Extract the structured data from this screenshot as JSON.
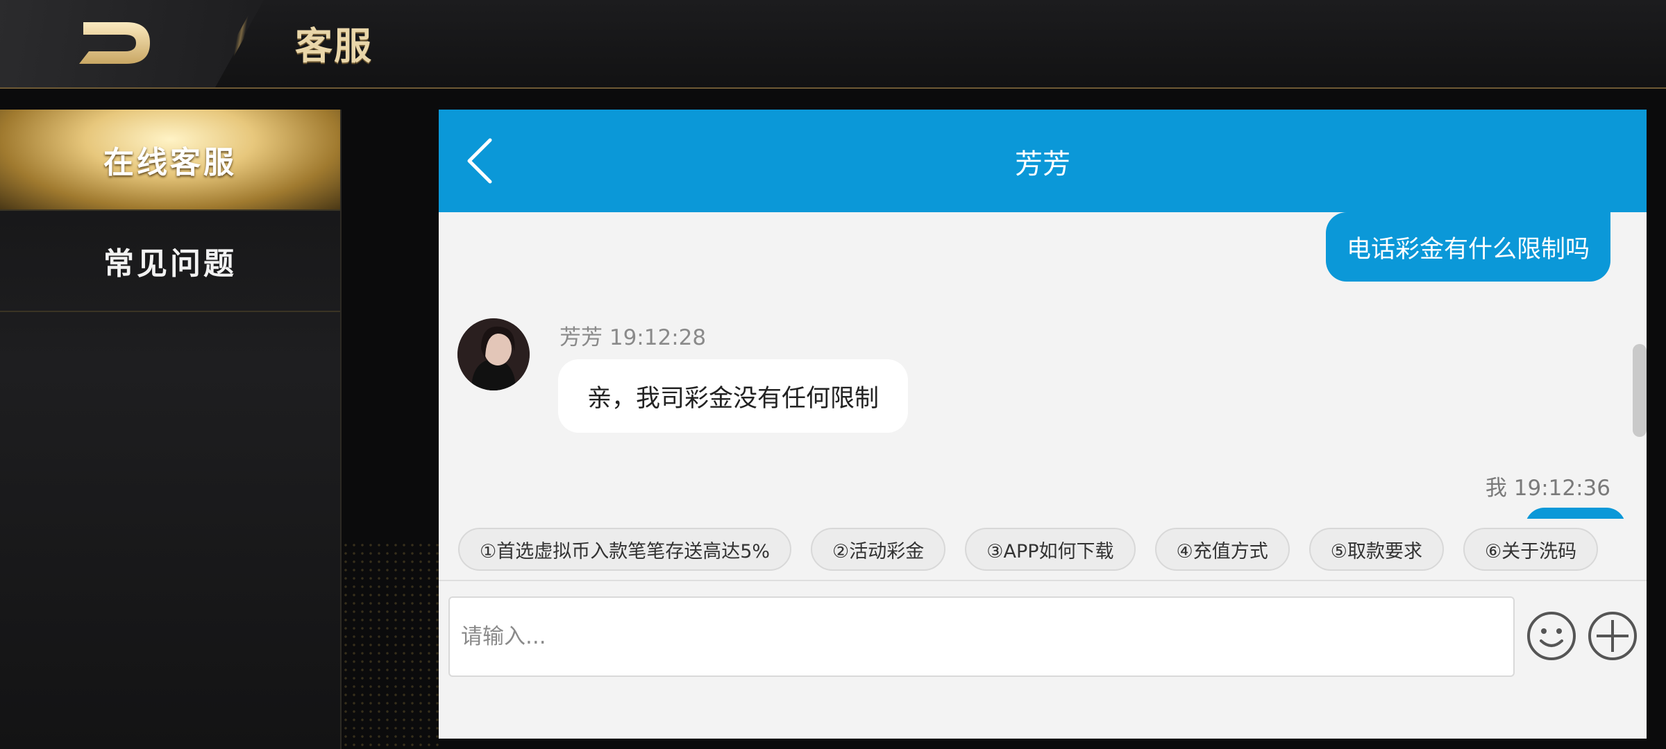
{
  "header": {
    "title": "客服"
  },
  "sidebar": {
    "items": [
      {
        "label": "在线客服",
        "active": true
      },
      {
        "label": "常见问题",
        "active": false
      }
    ]
  },
  "chat": {
    "agent_name": "芳芳",
    "messages": [
      {
        "sender": "me",
        "text": "电话彩金有什么限制吗"
      },
      {
        "sender": "agent",
        "meta": "芳芳 19:12:28",
        "text": "亲，我司彩金没有任何限制"
      },
      {
        "sender": "me",
        "meta": "我 19:12:36",
        "text": ""
      }
    ],
    "quick_replies": [
      "①首选虚拟币入款笔笔存送高达5%",
      "②活动彩金",
      "③APP如何下载",
      "④充值方式",
      "⑤取款要求",
      "⑥关于洗码"
    ],
    "input_placeholder": "请输入...",
    "icons": {
      "back": "chevron-left-icon",
      "emoji": "smiley-icon",
      "more": "plus-circle-icon"
    }
  },
  "colors": {
    "accent_blue": "#0b98d8",
    "gold": "#e9d6a9",
    "chat_bg": "#f3f3f3"
  }
}
